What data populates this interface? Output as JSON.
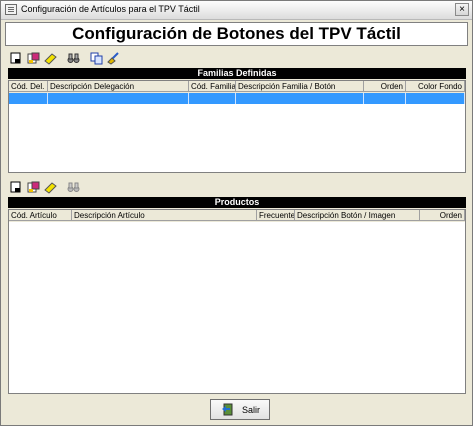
{
  "window": {
    "title": "Configuración de Artículos para el TPV Táctil",
    "close_glyph": "×"
  },
  "heading": "Configuración de Botones del TPV Táctil",
  "toolbar_icons": [
    "new-icon",
    "properties-icon",
    "eraser-icon",
    "binoculars-icon",
    "copy-icon",
    "broom-icon"
  ],
  "familias": {
    "title": "Familias Definidas",
    "columns": [
      "Cód. Del.",
      "Descripción Delegación",
      "Cód. Familia",
      "Descripción Familia / Botón",
      "Orden",
      "Color Fondo"
    ]
  },
  "productos": {
    "title": "Productos",
    "columns": [
      "Cód. Artículo",
      "Descripción Artículo",
      "Frecuente",
      "Descripción Botón / Imagen",
      "Orden"
    ]
  },
  "salir_label": "Salir"
}
